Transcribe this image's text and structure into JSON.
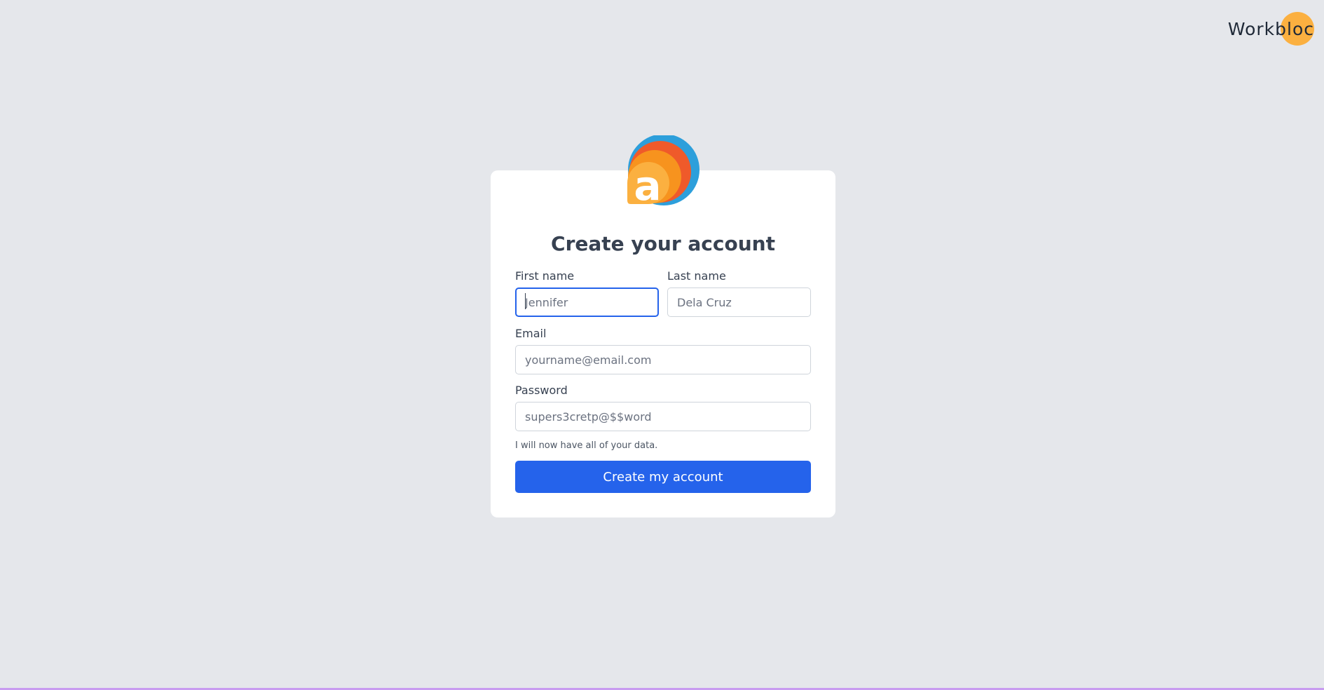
{
  "brand": {
    "name": "Workbloc",
    "accent_color": "#fbb040"
  },
  "logo": {
    "letter": "a",
    "colors": [
      "#2d9fdb",
      "#ef5a2a",
      "#f7931e",
      "#fbb040"
    ]
  },
  "form": {
    "title": "Create your account",
    "first_name": {
      "label": "First name",
      "placeholder": "Jennifer",
      "value": ""
    },
    "last_name": {
      "label": "Last name",
      "placeholder": "Dela Cruz",
      "value": ""
    },
    "email": {
      "label": "Email",
      "placeholder": "yourname@email.com",
      "value": ""
    },
    "password": {
      "label": "Password",
      "placeholder": "supers3cretp@$$word",
      "value": ""
    },
    "note": "I will now have all of your data.",
    "submit_label": "Create my account"
  },
  "colors": {
    "background": "#e5e7eb",
    "primary": "#2563eb",
    "focus_ring": "#2563eb"
  }
}
